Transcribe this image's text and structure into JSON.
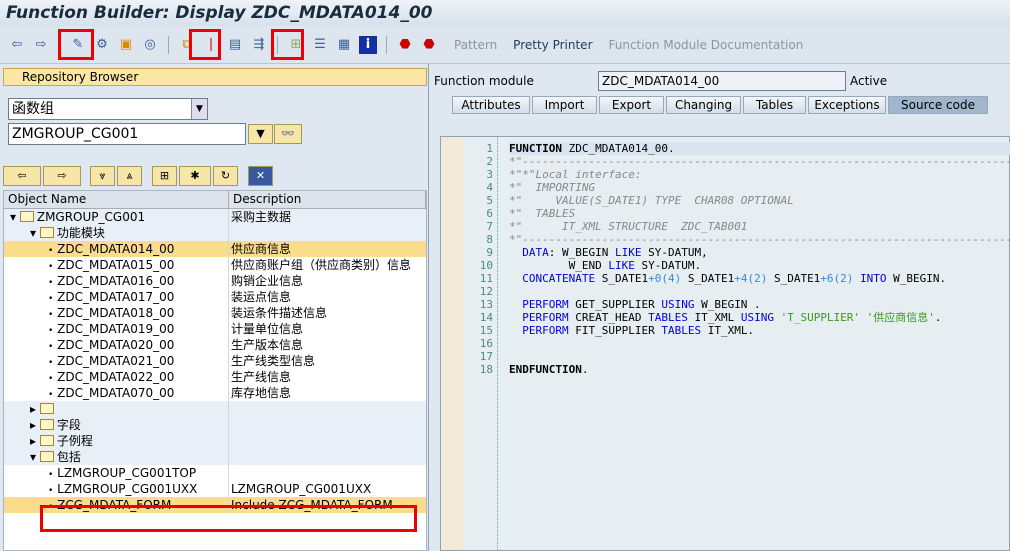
{
  "title": "Function Builder: Display ZDC_MDATA014_00",
  "toolbar": {
    "icons": [
      "back-icon",
      "forward-icon",
      "display-change-icon",
      "activate-icon",
      "other-object-icon",
      "where-used-icon",
      "check-icon",
      "test-icon",
      "display-object-list-icon",
      "navigation-window-icon",
      "info-icon",
      "breakpoint-icon",
      "session-breakpoint-icon"
    ],
    "pattern": "Pattern",
    "pretty_printer": "Pretty Printer",
    "docs": "Function Module Documentation"
  },
  "left": {
    "repo_title": "Repository Browser",
    "object_type": "函数组",
    "object_name": "ZMGROUP_CG001",
    "col_name": "Object Name",
    "col_desc": "Description",
    "rows": [
      {
        "name": "ZMGROUP_CG001",
        "desc": "采购主数据",
        "lvl": 0,
        "kind": "open"
      },
      {
        "name": "功能模块",
        "desc": "",
        "lvl": 1,
        "kind": "open"
      },
      {
        "name": "ZDC_MDATA014_00",
        "desc": "供应商信息",
        "lvl": 2,
        "kind": "leaf"
      },
      {
        "name": "ZDC_MDATA015_00",
        "desc": "供应商账户组（供应商类别）信息",
        "lvl": 2,
        "kind": "leaf"
      },
      {
        "name": "ZDC_MDATA016_00",
        "desc": "购销企业信息",
        "lvl": 2,
        "kind": "leaf"
      },
      {
        "name": "ZDC_MDATA017_00",
        "desc": "装运点信息",
        "lvl": 2,
        "kind": "leaf"
      },
      {
        "name": "ZDC_MDATA018_00",
        "desc": "装运条件描述信息",
        "lvl": 2,
        "kind": "leaf"
      },
      {
        "name": "ZDC_MDATA019_00",
        "desc": "计量单位信息",
        "lvl": 2,
        "kind": "leaf"
      },
      {
        "name": "ZDC_MDATA020_00",
        "desc": "生产版本信息",
        "lvl": 2,
        "kind": "leaf"
      },
      {
        "name": "ZDC_MDATA021_00",
        "desc": "生产线类型信息",
        "lvl": 2,
        "kind": "leaf"
      },
      {
        "name": "ZDC_MDATA022_00",
        "desc": "生产线信息",
        "lvl": 2,
        "kind": "leaf"
      },
      {
        "name": "ZDC_MDATA070_00",
        "desc": "库存地信息",
        "lvl": 2,
        "kind": "leaf"
      },
      {
        "name": "",
        "desc": "",
        "lvl": 1,
        "kind": "closed"
      },
      {
        "name": "字段",
        "desc": "",
        "lvl": 1,
        "kind": "closed"
      },
      {
        "name": "子例程",
        "desc": "",
        "lvl": 1,
        "kind": "closed"
      },
      {
        "name": "包括",
        "desc": "",
        "lvl": 1,
        "kind": "open"
      },
      {
        "name": "LZMGROUP_CG001TOP",
        "desc": "",
        "lvl": 2,
        "kind": "leaf"
      },
      {
        "name": "LZMGROUP_CG001UXX",
        "desc": "LZMGROUP_CG001UXX",
        "lvl": 2,
        "kind": "leaf"
      },
      {
        "name": "ZCG_MDATA_FORM",
        "desc": "Include ZCG_MDATA_FORM",
        "lvl": 2,
        "kind": "leaf"
      }
    ]
  },
  "right": {
    "fm_label": "Function module",
    "fm_value": "ZDC_MDATA014_00",
    "status": "Active",
    "tabs": [
      "Attributes",
      "Import",
      "Export",
      "Changing",
      "Tables",
      "Exceptions",
      "Source code"
    ],
    "active_tab": "Source code",
    "code": [
      "<span class='bd'>FUNCTION</span> ZDC_MDATA014_00.",
      "<span class='cm'>*\"----------------------------------------------------------------------------</span>",
      "<span class='cm'>*\"*\"Local interface:</span>",
      "<span class='cm'>*\"  IMPORTING</span>",
      "<span class='cm'>*\"     VALUE(S_DATE1) TYPE  CHAR08 OPTIONAL</span>",
      "<span class='cm'>*\"  TABLES</span>",
      "<span class='cm'>*\"      IT_XML STRUCTURE  ZDC_TAB001</span>",
      "<span class='cm'>*\"----------------------------------------------------------------------------</span>",
      "  <span class='kw'>DATA</span>: W_BEGIN <span class='kw'>LIKE</span> SY-DATUM,",
      "         W_END <span class='kw'>LIKE</span> SY-DATUM.",
      "  <span class='kw'>CONCATENATE</span> S_DATE1<span class='nm'>+0(4)</span> S_DATE1<span class='nm'>+4(2)</span> S_DATE1<span class='nm'>+6(2)</span> <span class='kw'>INTO</span> W_BEGIN.",
      "",
      "  <span class='kw'>PERFORM</span> GET_SUPPLIER <span class='kw'>USING</span> W_BEGIN .",
      "  <span class='kw'>PERFORM</span> CREAT_HEAD <span class='kw'>TABLES</span> IT_XML <span class='kw'>USING</span> <span class='st'>'T_SUPPLIER' '供应商信息'</span>.",
      "  <span class='kw'>PERFORM</span> FIT_SUPPLIER <span class='kw'>TABLES</span> IT_XML.",
      "",
      "",
      "<span class='bd'>ENDFUNCTION</span>."
    ]
  }
}
